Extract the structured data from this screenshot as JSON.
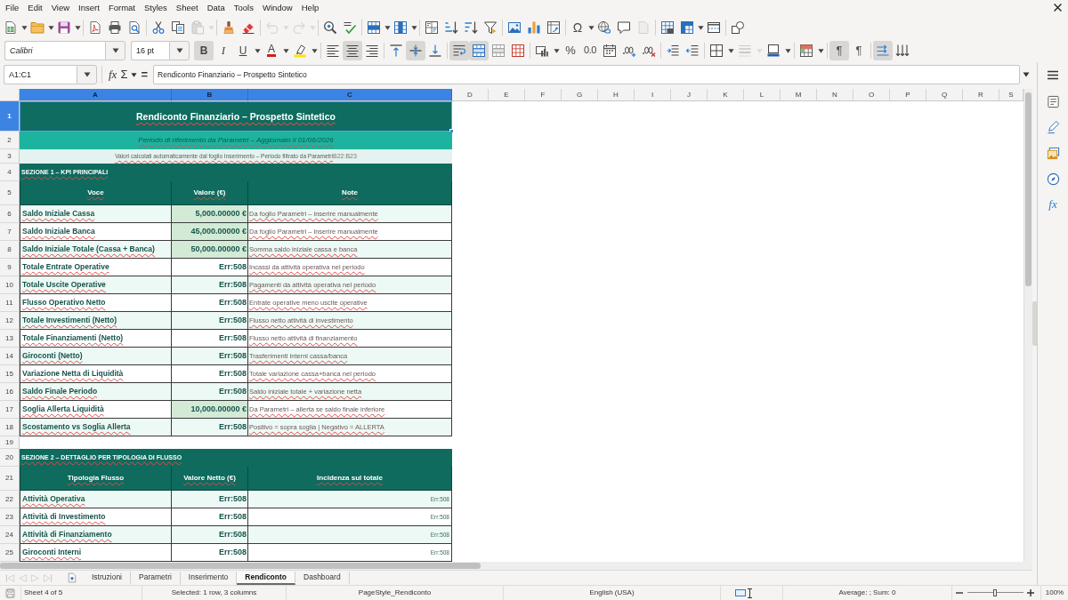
{
  "menu_bar": [
    "File",
    "Edit",
    "View",
    "Insert",
    "Format",
    "Styles",
    "Sheet",
    "Data",
    "Tools",
    "Window",
    "Help"
  ],
  "standard_toolbar": [
    [
      {
        "kind": "new",
        "disabled": false
      },
      {
        "kind": "caret",
        "disabled": false
      },
      {
        "kind": "open",
        "disabled": false
      },
      {
        "kind": "caret",
        "disabled": false
      },
      {
        "kind": "save",
        "disabled": false
      },
      {
        "kind": "caret",
        "disabled": false
      }
    ],
    [
      {
        "kind": "export_pdf",
        "disabled": false
      },
      {
        "kind": "print",
        "disabled": false
      },
      {
        "kind": "print_preview",
        "disabled": false
      }
    ],
    [
      {
        "kind": "cut",
        "disabled": false
      },
      {
        "kind": "copy",
        "disabled": false
      },
      {
        "kind": "paste",
        "disabled": true
      },
      {
        "kind": "caret",
        "disabled": true
      }
    ],
    [
      {
        "kind": "clone",
        "disabled": false
      },
      {
        "kind": "clear",
        "disabled": false
      }
    ],
    [
      {
        "kind": "undo",
        "disabled": true
      },
      {
        "kind": "caret",
        "disabled": true
      },
      {
        "kind": "redo",
        "disabled": true
      },
      {
        "kind": "caret",
        "disabled": true
      }
    ],
    [
      {
        "kind": "find",
        "disabled": false
      },
      {
        "kind": "spelling",
        "disabled": false
      }
    ],
    [
      {
        "kind": "rows",
        "disabled": false
      },
      {
        "kind": "caret",
        "disabled": false
      },
      {
        "kind": "columns",
        "disabled": false
      },
      {
        "kind": "caret",
        "disabled": false
      }
    ],
    [
      {
        "kind": "sort",
        "disabled": false
      },
      {
        "kind": "sort_ascending",
        "disabled": false
      },
      {
        "kind": "sort_descending",
        "disabled": false
      },
      {
        "kind": "autofilter",
        "disabled": false
      }
    ],
    [
      {
        "kind": "image",
        "disabled": false
      },
      {
        "kind": "chart",
        "disabled": false
      },
      {
        "kind": "pivot",
        "disabled": false
      }
    ],
    [
      {
        "kind": "special_character",
        "label": "Ω",
        "disabled": false
      },
      {
        "kind": "caret",
        "disabled": false
      },
      {
        "kind": "hyperlink",
        "disabled": false
      },
      {
        "kind": "comment",
        "disabled": false
      },
      {
        "kind": "headers",
        "disabled": true
      }
    ],
    [
      {
        "kind": "print_area",
        "disabled": false
      },
      {
        "kind": "freeze",
        "disabled": false
      },
      {
        "kind": "caret",
        "disabled": false
      },
      {
        "kind": "split",
        "disabled": false
      }
    ],
    [
      {
        "kind": "shapes",
        "disabled": false
      }
    ]
  ],
  "formatting_toolbar": {
    "font_name": "Calibri",
    "font_size": "16 pt",
    "groups": [
      [
        {
          "kind": "bold",
          "label": "B",
          "active": true,
          "disabled": false
        },
        {
          "kind": "italic",
          "label": "I",
          "active": false,
          "disabled": false
        },
        {
          "kind": "underline",
          "label": "U",
          "active": false,
          "disabled": false
        },
        {
          "kind": "caret",
          "active": false,
          "disabled": false
        },
        {
          "kind": "font_color",
          "label": "A",
          "active": false,
          "disabled": false
        },
        {
          "kind": "caret",
          "active": false,
          "disabled": false
        },
        {
          "kind": "highlight",
          "active": false,
          "disabled": false
        },
        {
          "kind": "caret",
          "active": false,
          "disabled": false
        }
      ],
      [
        {
          "kind": "align_left",
          "active": false,
          "disabled": false
        },
        {
          "kind": "align_center",
          "active": true,
          "disabled": false
        },
        {
          "kind": "align_right",
          "active": false,
          "disabled": false
        }
      ],
      [
        {
          "kind": "align_top",
          "active": false,
          "disabled": false
        },
        {
          "kind": "align_middle",
          "active": true,
          "disabled": false
        },
        {
          "kind": "align_bottom",
          "active": false,
          "disabled": false
        }
      ],
      [
        {
          "kind": "wrap",
          "active": true,
          "disabled": false
        },
        {
          "kind": "merge_center",
          "active": true,
          "disabled": false
        },
        {
          "kind": "merge",
          "active": false,
          "disabled": false
        },
        {
          "kind": "unmerge",
          "active": false,
          "disabled": false
        }
      ],
      [
        {
          "kind": "number_format",
          "active": false,
          "disabled": false
        },
        {
          "kind": "caret",
          "active": false,
          "disabled": false
        },
        {
          "kind": "percent",
          "label": "%",
          "active": false,
          "disabled": false
        },
        {
          "kind": "decimal_format",
          "label": "0.0",
          "active": false,
          "disabled": false
        },
        {
          "kind": "date",
          "active": false,
          "disabled": false
        },
        {
          "kind": "add_decimal",
          "active": false,
          "disabled": false
        },
        {
          "kind": "delete_decimal",
          "active": false,
          "disabled": false
        }
      ],
      [
        {
          "kind": "indent",
          "active": false,
          "disabled": false
        },
        {
          "kind": "outdent",
          "active": false,
          "disabled": false
        }
      ],
      [
        {
          "kind": "borders",
          "active": false,
          "disabled": false
        },
        {
          "kind": "caret",
          "active": false,
          "disabled": false
        },
        {
          "kind": "line_style",
          "active": false,
          "disabled": true
        },
        {
          "kind": "caret",
          "active": false,
          "disabled": true
        },
        {
          "kind": "border_color",
          "active": false,
          "disabled": false
        },
        {
          "kind": "caret",
          "active": false,
          "disabled": false
        }
      ],
      [
        {
          "kind": "conditional",
          "active": false,
          "disabled": false
        },
        {
          "kind": "caret",
          "active": false,
          "disabled": false
        }
      ],
      [
        {
          "kind": "ltr",
          "label": "¶",
          "active": true,
          "disabled": false
        },
        {
          "kind": "rtl",
          "label": "¶",
          "active": false,
          "disabled": false
        }
      ],
      [
        {
          "kind": "text_direction",
          "active": true,
          "disabled": false
        },
        {
          "kind": "vertical_text",
          "active": false,
          "disabled": false
        }
      ]
    ]
  },
  "formula_bar": {
    "name_box": "A1:C1",
    "function_wizard": "fx",
    "sum": "Σ",
    "formula": "=",
    "content": "Rendiconto Finanziario – Prospetto Sintetico"
  },
  "sidebar": [
    {
      "kind": "properties"
    },
    {
      "kind": "styles"
    },
    {
      "kind": "gallery"
    },
    {
      "kind": "navigator"
    },
    {
      "kind": "functions",
      "label": "fx"
    }
  ],
  "sheet": {
    "autospell": true,
    "columns": [
      {
        "label": "A",
        "selected": true
      },
      {
        "label": "B",
        "selected": true
      },
      {
        "label": "C",
        "selected": true
      },
      {
        "label": "D",
        "selected": false
      },
      {
        "label": "E",
        "selected": false
      },
      {
        "label": "F",
        "selected": false
      },
      {
        "label": "G",
        "selected": false
      },
      {
        "label": "H",
        "selected": false
      },
      {
        "label": "I",
        "selected": false
      },
      {
        "label": "J",
        "selected": false
      },
      {
        "label": "K",
        "selected": false
      },
      {
        "label": "L",
        "selected": false
      },
      {
        "label": "M",
        "selected": false
      },
      {
        "label": "N",
        "selected": false
      },
      {
        "label": "O",
        "selected": false
      },
      {
        "label": "P",
        "selected": false
      },
      {
        "label": "Q",
        "selected": false
      },
      {
        "label": "R",
        "selected": false
      },
      {
        "label": "S",
        "selected": false
      }
    ],
    "rows": [
      {
        "number": "1",
        "selected": true,
        "kind": "title",
        "text": "Rendiconto Finanziario – Prospetto Sintetico"
      },
      {
        "number": "2",
        "selected": false,
        "kind": "subtitle",
        "text": "Periodo di riferimento da Parametri – Aggiornato il 01/06/2026"
      },
      {
        "number": "3",
        "selected": false,
        "kind": "caption",
        "text": "Valori calcolati automaticamente dal foglio Inserimento – Periodo filtrato da Parametri",
        "reference": "B22:B23"
      },
      {
        "number": "4",
        "selected": false,
        "kind": "section",
        "text": "SEZIONE 1 – KPI PRINCIPALI"
      },
      {
        "number": "5",
        "selected": false,
        "kind": "header",
        "cells": [
          "Voce",
          "Valore (€)",
          "Note"
        ]
      },
      {
        "number": "6",
        "selected": false,
        "kind": "data",
        "shaded": true,
        "label": "Saldo Iniziale Cassa",
        "value": "5,000.00000 €",
        "input": true,
        "note": "Da foglio Parametri – inserire manualmente"
      },
      {
        "number": "7",
        "selected": false,
        "kind": "data",
        "shaded": false,
        "label": "Saldo Iniziale Banca",
        "value": "45,000.00000 €",
        "input": true,
        "note": "Da foglio Parametri – inserire manualmente"
      },
      {
        "number": "8",
        "selected": false,
        "kind": "data",
        "shaded": true,
        "label": "Saldo Iniziale Totale (Cassa + Banca)",
        "value": "50,000.00000 €",
        "input": true,
        "note": "Somma saldo iniziale cassa e banca"
      },
      {
        "number": "9",
        "selected": false,
        "kind": "data",
        "shaded": false,
        "label": "Totale Entrate Operative",
        "value": "Err:508",
        "input": false,
        "note": "Incassi da attività operativa nel periodo"
      },
      {
        "number": "10",
        "selected": false,
        "kind": "data",
        "shaded": true,
        "label": "Totale Uscite Operative",
        "value": "Err:508",
        "input": false,
        "note": "Pagamenti da attività operativa nel periodo"
      },
      {
        "number": "11",
        "selected": false,
        "kind": "data",
        "shaded": false,
        "label": "Flusso Operativo Netto",
        "value": "Err:508",
        "input": false,
        "note": "Entrate operative meno uscite operative"
      },
      {
        "number": "12",
        "selected": false,
        "kind": "data",
        "shaded": true,
        "label": "Totale Investimenti (Netto)",
        "value": "Err:508",
        "input": false,
        "note": "Flusso netto attività di investimento"
      },
      {
        "number": "13",
        "selected": false,
        "kind": "data",
        "shaded": false,
        "label": "Totale Finanziamenti (Netto)",
        "value": "Err:508",
        "input": false,
        "note": "Flusso netto attività di finanziamento"
      },
      {
        "number": "14",
        "selected": false,
        "kind": "data",
        "shaded": true,
        "label": "Giroconti (Netto)",
        "value": "Err:508",
        "input": false,
        "note": "Trasferimenti interni cassa/banca"
      },
      {
        "number": "15",
        "selected": false,
        "kind": "data",
        "shaded": false,
        "label": "Variazione Netta di Liquidità",
        "value": "Err:508",
        "input": false,
        "note": "Totale variazione cassa+banca nel periodo"
      },
      {
        "number": "16",
        "selected": false,
        "kind": "data",
        "shaded": true,
        "label": "Saldo Finale Periodo",
        "value": "Err:508",
        "input": false,
        "note": "Saldo iniziale totale + variazione netta"
      },
      {
        "number": "17",
        "selected": false,
        "kind": "data",
        "shaded": false,
        "label": "Soglia Allerta Liquidità",
        "value": "10,000.00000 €",
        "input": true,
        "note": "Da Parametri – allerta se saldo finale inferiore"
      },
      {
        "number": "18",
        "selected": false,
        "kind": "data",
        "shaded": true,
        "label": "Scostamento vs Soglia Allerta",
        "value": "Err:508",
        "input": false,
        "note": "Positivo = sopra soglia | Negativo = ALLERTA"
      },
      {
        "number": "19",
        "selected": false,
        "kind": "blank"
      },
      {
        "number": "20",
        "selected": false,
        "kind": "section",
        "text": "SEZIONE 2 – DETTAGLIO PER TIPOLOGIA DI FLUSSO"
      },
      {
        "number": "21",
        "selected": false,
        "kind": "header",
        "cells": [
          "Tipologia Flusso",
          "Valore Netto (€)",
          "Incidenza sul totale"
        ]
      },
      {
        "number": "22",
        "selected": false,
        "kind": "detail",
        "shaded": true,
        "label": "Attività Operativa",
        "value": "Err:508",
        "share": "Err:508"
      },
      {
        "number": "23",
        "selected": false,
        "kind": "detail",
        "shaded": false,
        "label": "Attività di Investimento",
        "value": "Err:508",
        "share": "Err:508"
      },
      {
        "number": "24",
        "selected": false,
        "kind": "detail",
        "shaded": true,
        "label": "Attività di Finanziamento",
        "value": "Err:508",
        "share": "Err:508"
      },
      {
        "number": "25",
        "selected": false,
        "kind": "detail",
        "shaded": false,
        "label": "Giroconti Interni",
        "value": "Err:508",
        "share": "Err:508"
      }
    ]
  },
  "sheet_navigation": [
    {
      "kind": "first",
      "disabled": true
    },
    {
      "kind": "previous",
      "disabled": true
    },
    {
      "kind": "next",
      "disabled": true
    },
    {
      "kind": "last",
      "disabled": true
    }
  ],
  "sheet_tabs": [
    {
      "label": "Istruzioni",
      "selected": false
    },
    {
      "label": "Parametri",
      "selected": false
    },
    {
      "label": "Inserimento",
      "selected": false
    },
    {
      "label": "Rendiconto",
      "selected": true
    },
    {
      "label": "Dashboard",
      "selected": false
    }
  ],
  "status_bar": {
    "sheet": "Sheet 4 of 5",
    "selection": "Selected: 1 row, 3 columns",
    "page_style": "PageStyle_Rendiconto",
    "language": "English (USA)",
    "summary": "Average: ; Sum: 0",
    "zoom_slider": {
      "level": 0.5
    },
    "zoom": "100%"
  }
}
